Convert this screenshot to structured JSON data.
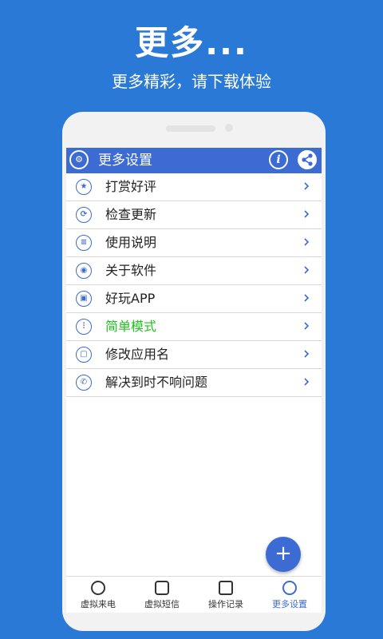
{
  "promo": {
    "title": "更多...",
    "subtitle": "更多精彩，请下载体验"
  },
  "appbar": {
    "title": "更多设置",
    "info_label": "i",
    "app_icon": "app-gear-icon",
    "share_icon": "share-icon"
  },
  "menu": [
    {
      "label": "打赏好评",
      "icon": "star-icon"
    },
    {
      "label": "检查更新",
      "icon": "refresh-icon"
    },
    {
      "label": "使用说明",
      "icon": "instructions-icon"
    },
    {
      "label": "关于软件",
      "icon": "eye-icon"
    },
    {
      "label": "好玩APP",
      "icon": "app-icon"
    },
    {
      "label": "简单模式",
      "icon": "equalizer-icon"
    },
    {
      "label": "修改应用名",
      "icon": "app-rename-icon"
    },
    {
      "label": "解决到时不响问题",
      "icon": "phone-icon"
    }
  ],
  "fab": {
    "label": "+"
  },
  "tabs": [
    {
      "label": "虚拟来电",
      "icon": "phone-icon"
    },
    {
      "label": "虚拟短信",
      "icon": "message-icon"
    },
    {
      "label": "操作记录",
      "icon": "edit-icon"
    },
    {
      "label": "更多设置",
      "icon": "settings-icon"
    }
  ],
  "colors": {
    "background": "#2b79d6",
    "accent": "#3c6bd3",
    "highlight": "#22c21e"
  }
}
